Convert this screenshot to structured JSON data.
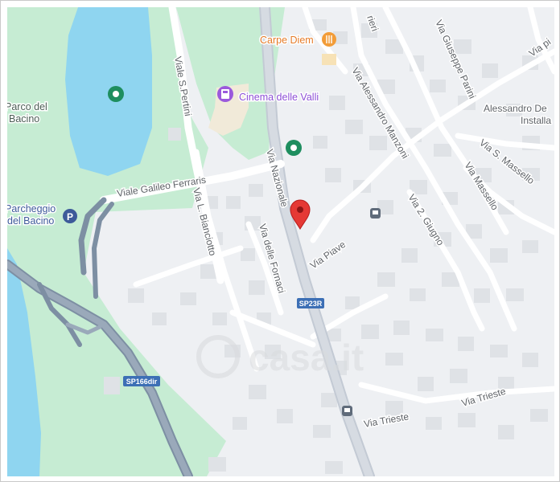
{
  "map": {
    "pois": {
      "carpe_diem": "Carpe Diem",
      "cinema": "Cinema delle Valli",
      "parco": [
        "Parco del",
        "Bacino"
      ],
      "parcheggio": [
        "Parcheggio",
        "del Bacino"
      ],
      "alessandro": [
        "Alessandro De",
        "Installa"
      ]
    },
    "streets": {
      "viale_galileo_ferraris": "Viale Galileo Ferraris",
      "viale_s_pertini": "Viale S.Pertini",
      "via_nazionale": "Via Nazionale",
      "via_l_bianciotto": "Via L. Bianciotto",
      "via_delle_fornaci": "Via delle Fornaci",
      "via_piave": "Via Piave",
      "via_alessandro_manzoni": "Via Alessandro Manzoni",
      "via_giuseppe_parini": "Via Giuseppe Parini",
      "via_s_massello": "Via S. Massello",
      "via_massello": "Via Massello",
      "via_2_giugno": "Via 2. Giugno",
      "via_trieste_1": "Via Trieste",
      "via_trieste_2": "Via Trieste",
      "top_partial": "rieri",
      "top_right_partial": "Via pi"
    },
    "road_shields": {
      "sp23r": "SP23R",
      "sp166dir": "SP166dir"
    },
    "watermark": "casa.it",
    "colors": {
      "water": "#8fd5f0",
      "park": "#c6ecd3",
      "land": "#eef0f3",
      "building": "#dfe2e6",
      "road": "#ffffff",
      "major_road": "#a9b3c0",
      "highway": "#8294a9",
      "pin_red": "#e53935",
      "poi_green": "#1e8e5f",
      "parking_blue": "#3d5a9a",
      "food_orange": "#f29c38",
      "cinema_purple": "#9b59dc"
    }
  }
}
